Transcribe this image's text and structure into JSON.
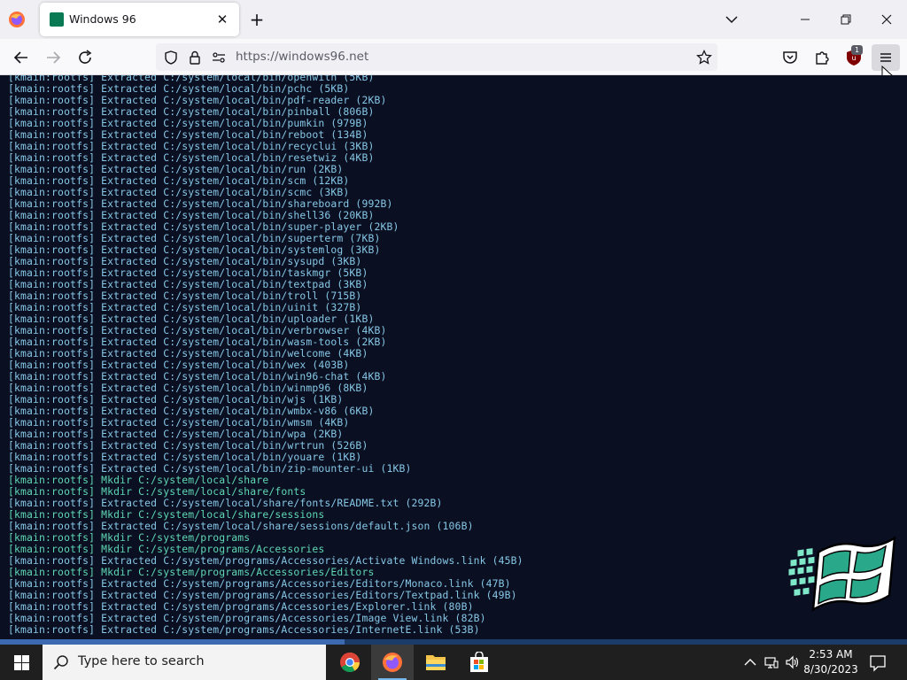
{
  "browser": {
    "tab_title": "Windows 96",
    "url": "https://windows96.net",
    "extension_badge": "1"
  },
  "terminal": {
    "lines": [
      {
        "text": "[kmain:rootfs] Extracted C:/system/local/bin/openwith (5KB)",
        "color": "blue"
      },
      {
        "text": "[kmain:rootfs] Extracted C:/system/local/bin/pchc (5KB)",
        "color": "blue"
      },
      {
        "text": "[kmain:rootfs] Extracted C:/system/local/bin/pdf-reader (2KB)",
        "color": "blue"
      },
      {
        "text": "[kmain:rootfs] Extracted C:/system/local/bin/pinball (806B)",
        "color": "blue"
      },
      {
        "text": "[kmain:rootfs] Extracted C:/system/local/bin/pumkin (979B)",
        "color": "blue"
      },
      {
        "text": "[kmain:rootfs] Extracted C:/system/local/bin/reboot (134B)",
        "color": "blue"
      },
      {
        "text": "[kmain:rootfs] Extracted C:/system/local/bin/recyclui (3KB)",
        "color": "blue"
      },
      {
        "text": "[kmain:rootfs] Extracted C:/system/local/bin/resetwiz (4KB)",
        "color": "blue"
      },
      {
        "text": "[kmain:rootfs] Extracted C:/system/local/bin/run (2KB)",
        "color": "blue"
      },
      {
        "text": "[kmain:rootfs] Extracted C:/system/local/bin/scm (12KB)",
        "color": "blue"
      },
      {
        "text": "[kmain:rootfs] Extracted C:/system/local/bin/scmc (3KB)",
        "color": "blue"
      },
      {
        "text": "[kmain:rootfs] Extracted C:/system/local/bin/shareboard (992B)",
        "color": "blue"
      },
      {
        "text": "[kmain:rootfs] Extracted C:/system/local/bin/shell36 (20KB)",
        "color": "blue"
      },
      {
        "text": "[kmain:rootfs] Extracted C:/system/local/bin/super-player (2KB)",
        "color": "blue"
      },
      {
        "text": "[kmain:rootfs] Extracted C:/system/local/bin/superterm (7KB)",
        "color": "blue"
      },
      {
        "text": "[kmain:rootfs] Extracted C:/system/local/bin/systemlog (3KB)",
        "color": "blue"
      },
      {
        "text": "[kmain:rootfs] Extracted C:/system/local/bin/sysupd (3KB)",
        "color": "blue"
      },
      {
        "text": "[kmain:rootfs] Extracted C:/system/local/bin/taskmgr (5KB)",
        "color": "blue"
      },
      {
        "text": "[kmain:rootfs] Extracted C:/system/local/bin/textpad (3KB)",
        "color": "blue"
      },
      {
        "text": "[kmain:rootfs] Extracted C:/system/local/bin/troll (715B)",
        "color": "blue"
      },
      {
        "text": "[kmain:rootfs] Extracted C:/system/local/bin/uinit (327B)",
        "color": "blue"
      },
      {
        "text": "[kmain:rootfs] Extracted C:/system/local/bin/uploader (1KB)",
        "color": "blue"
      },
      {
        "text": "[kmain:rootfs] Extracted C:/system/local/bin/verbrowser (4KB)",
        "color": "blue"
      },
      {
        "text": "[kmain:rootfs] Extracted C:/system/local/bin/wasm-tools (2KB)",
        "color": "blue"
      },
      {
        "text": "[kmain:rootfs] Extracted C:/system/local/bin/welcome (4KB)",
        "color": "blue"
      },
      {
        "text": "[kmain:rootfs] Extracted C:/system/local/bin/wex (403B)",
        "color": "blue"
      },
      {
        "text": "[kmain:rootfs] Extracted C:/system/local/bin/win96-chat (4KB)",
        "color": "blue"
      },
      {
        "text": "[kmain:rootfs] Extracted C:/system/local/bin/winmp96 (8KB)",
        "color": "blue"
      },
      {
        "text": "[kmain:rootfs] Extracted C:/system/local/bin/wjs (1KB)",
        "color": "blue"
      },
      {
        "text": "[kmain:rootfs] Extracted C:/system/local/bin/wmbx-v86 (6KB)",
        "color": "blue"
      },
      {
        "text": "[kmain:rootfs] Extracted C:/system/local/bin/wmsm (4KB)",
        "color": "blue"
      },
      {
        "text": "[kmain:rootfs] Extracted C:/system/local/bin/wpa (2KB)",
        "color": "blue"
      },
      {
        "text": "[kmain:rootfs] Extracted C:/system/local/bin/wrtrun (526B)",
        "color": "blue"
      },
      {
        "text": "[kmain:rootfs] Extracted C:/system/local/bin/youare (1KB)",
        "color": "blue"
      },
      {
        "text": "[kmain:rootfs] Extracted C:/system/local/bin/zip-mounter-ui (1KB)",
        "color": "blue"
      },
      {
        "text": "[kmain:rootfs] Mkdir C:/system/local/share",
        "color": "green"
      },
      {
        "text": "[kmain:rootfs] Mkdir C:/system/local/share/fonts",
        "color": "green"
      },
      {
        "text": "[kmain:rootfs] Extracted C:/system/local/share/fonts/README.txt (292B)",
        "color": "blue"
      },
      {
        "text": "[kmain:rootfs] Mkdir C:/system/local/share/sessions",
        "color": "green"
      },
      {
        "text": "[kmain:rootfs] Extracted C:/system/local/share/sessions/default.json (106B)",
        "color": "blue"
      },
      {
        "text": "[kmain:rootfs] Mkdir C:/system/programs",
        "color": "green"
      },
      {
        "text": "[kmain:rootfs] Mkdir C:/system/programs/Accessories",
        "color": "green"
      },
      {
        "text": "[kmain:rootfs] Extracted C:/system/programs/Accessories/Activate Windows.link (45B)",
        "color": "blue"
      },
      {
        "text": "[kmain:rootfs] Mkdir C:/system/programs/Accessories/Editors",
        "color": "green"
      },
      {
        "text": "[kmain:rootfs] Extracted C:/system/programs/Accessories/Editors/Monaco.link (47B)",
        "color": "blue"
      },
      {
        "text": "[kmain:rootfs] Extracted C:/system/programs/Accessories/Editors/Textpad.link (49B)",
        "color": "blue"
      },
      {
        "text": "[kmain:rootfs] Extracted C:/system/programs/Accessories/Explorer.link (80B)",
        "color": "blue"
      },
      {
        "text": "[kmain:rootfs] Extracted C:/system/programs/Accessories/Image View.link (82B)",
        "color": "blue"
      },
      {
        "text": "[kmain:rootfs] Extracted C:/system/programs/Accessories/InternetE.link (53B)",
        "color": "blue"
      }
    ],
    "scroll_position": 0.38
  },
  "taskbar": {
    "search_placeholder": "Type here to search",
    "time": "2:53 AM",
    "date": "8/30/2023",
    "apps": [
      {
        "name": "chrome-icon",
        "active": false
      },
      {
        "name": "firefox-icon",
        "active": true
      },
      {
        "name": "file-explorer-icon",
        "active": false
      },
      {
        "name": "store-icon",
        "active": false
      }
    ]
  },
  "colors": {
    "terminal_bg": "#0b0f22",
    "terminal_text": "#86c8e6",
    "terminal_mkdir": "#5fd8b5",
    "taskbar_bg": "#1f1f1f",
    "accent": "#76b9ed"
  }
}
